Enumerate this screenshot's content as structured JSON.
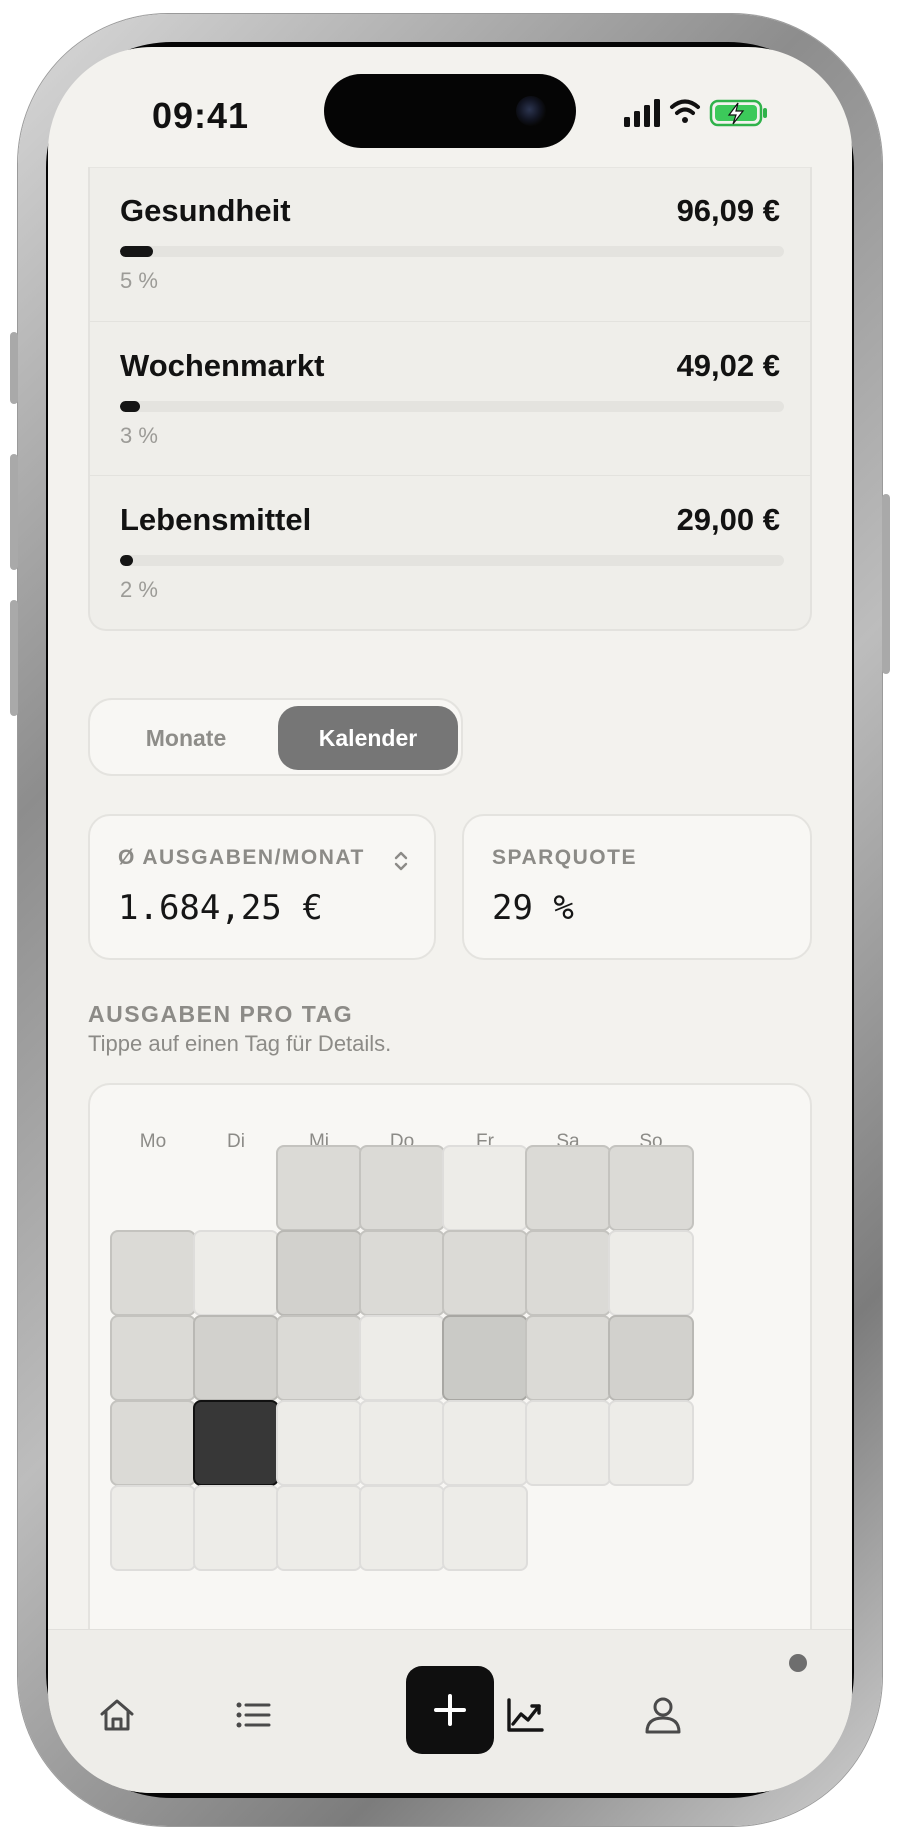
{
  "status_bar": {
    "time": "09:41"
  },
  "categories": [
    {
      "name": "Gesundheit",
      "amount": "96,09 €",
      "percent_label": "5 %",
      "share": 0.05
    },
    {
      "name": "Wochenmarkt",
      "amount": "49,02 €",
      "percent_label": "3 %",
      "share": 0.03
    },
    {
      "name": "Lebensmittel",
      "amount": "29,00 €",
      "percent_label": "2 %",
      "share": 0.02
    }
  ],
  "segment": {
    "months_label": "Monate",
    "calendar_label": "Kalender",
    "selected": "Kalender"
  },
  "stats": {
    "avg_label": "Ø AUSGABEN/MONAT",
    "avg_value": "1.684,25 €",
    "savings_label": "SPARQUOTE",
    "savings_value": "29 %"
  },
  "daily": {
    "title": "AUSGABEN PRO TAG",
    "subtitle": "Tippe auf einen Tag für Details.",
    "weekdays": [
      "Mo",
      "Di",
      "Mi",
      "Do",
      "Fr",
      "Sa",
      "So"
    ],
    "first_weekday_index": 2,
    "intensity": [
      2,
      2,
      1,
      2,
      2,
      2,
      1,
      3,
      2,
      2,
      2,
      1,
      2,
      3,
      2,
      1,
      4,
      2,
      3,
      2,
      9,
      1,
      1,
      1,
      1,
      1,
      1,
      1,
      1,
      1,
      1
    ]
  },
  "colors": {
    "accent": "#0f0f0f",
    "background": "#f3f2ee"
  },
  "nav": {
    "items": [
      "home-icon",
      "list-icon",
      "plus-icon",
      "chart-icon",
      "profile-icon"
    ]
  }
}
